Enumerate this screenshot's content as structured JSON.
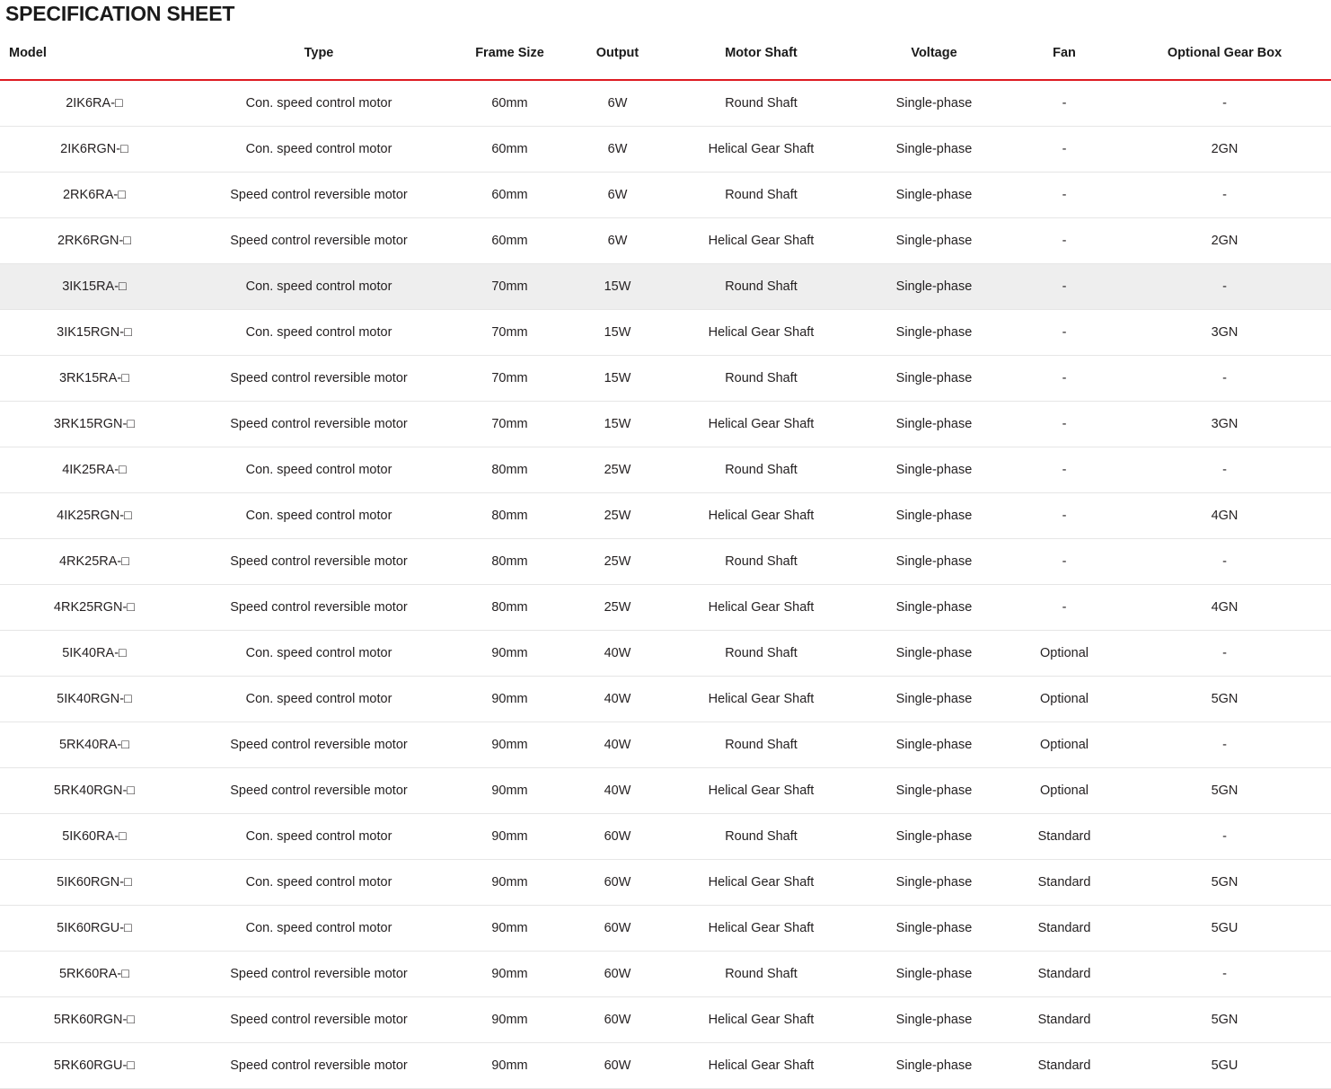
{
  "title": "SPECIFICATION SHEET",
  "accent_color": "#dd1a21",
  "highlight_row_color": "#eeeeee",
  "row_divider_color": "#e6e6e6",
  "table": {
    "columns": [
      {
        "key": "model",
        "label": "Model"
      },
      {
        "key": "type",
        "label": "Type"
      },
      {
        "key": "frame",
        "label": "Frame Size"
      },
      {
        "key": "output",
        "label": "Output"
      },
      {
        "key": "shaft",
        "label": "Motor Shaft"
      },
      {
        "key": "voltage",
        "label": "Voltage"
      },
      {
        "key": "fan",
        "label": "Fan"
      },
      {
        "key": "gearbox",
        "label": "Optional Gear Box"
      }
    ],
    "highlighted_row_index": 4,
    "rows": [
      {
        "model": "2IK6RA-□",
        "type": "Con. speed control motor",
        "frame": "60mm",
        "output": "6W",
        "shaft": "Round Shaft",
        "voltage": "Single-phase",
        "fan": "-",
        "gearbox": "-"
      },
      {
        "model": "2IK6RGN-□",
        "type": "Con. speed control motor",
        "frame": "60mm",
        "output": "6W",
        "shaft": "Helical Gear Shaft",
        "voltage": "Single-phase",
        "fan": "-",
        "gearbox": "2GN"
      },
      {
        "model": "2RK6RA-□",
        "type": "Speed control reversible motor",
        "frame": "60mm",
        "output": "6W",
        "shaft": "Round Shaft",
        "voltage": "Single-phase",
        "fan": "-",
        "gearbox": "-"
      },
      {
        "model": "2RK6RGN-□",
        "type": "Speed control reversible motor",
        "frame": "60mm",
        "output": "6W",
        "shaft": "Helical Gear Shaft",
        "voltage": "Single-phase",
        "fan": "-",
        "gearbox": "2GN"
      },
      {
        "model": "3IK15RA-□",
        "type": "Con. speed control motor",
        "frame": "70mm",
        "output": "15W",
        "shaft": "Round Shaft",
        "voltage": "Single-phase",
        "fan": "-",
        "gearbox": "-"
      },
      {
        "model": "3IK15RGN-□",
        "type": "Con. speed control motor",
        "frame": "70mm",
        "output": "15W",
        "shaft": "Helical Gear Shaft",
        "voltage": "Single-phase",
        "fan": "-",
        "gearbox": "3GN"
      },
      {
        "model": "3RK15RA-□",
        "type": "Speed control reversible motor",
        "frame": "70mm",
        "output": "15W",
        "shaft": "Round Shaft",
        "voltage": "Single-phase",
        "fan": "-",
        "gearbox": "-"
      },
      {
        "model": "3RK15RGN-□",
        "type": "Speed control reversible motor",
        "frame": "70mm",
        "output": "15W",
        "shaft": "Helical Gear Shaft",
        "voltage": "Single-phase",
        "fan": "-",
        "gearbox": "3GN"
      },
      {
        "model": "4IK25RA-□",
        "type": "Con. speed control motor",
        "frame": "80mm",
        "output": "25W",
        "shaft": "Round Shaft",
        "voltage": "Single-phase",
        "fan": "-",
        "gearbox": "-"
      },
      {
        "model": "4IK25RGN-□",
        "type": "Con. speed control motor",
        "frame": "80mm",
        "output": "25W",
        "shaft": "Helical Gear Shaft",
        "voltage": "Single-phase",
        "fan": "-",
        "gearbox": "4GN"
      },
      {
        "model": "4RK25RA-□",
        "type": "Speed control reversible motor",
        "frame": "80mm",
        "output": "25W",
        "shaft": "Round Shaft",
        "voltage": "Single-phase",
        "fan": "-",
        "gearbox": "-"
      },
      {
        "model": "4RK25RGN-□",
        "type": "Speed control reversible motor",
        "frame": "80mm",
        "output": "25W",
        "shaft": "Helical Gear Shaft",
        "voltage": "Single-phase",
        "fan": "-",
        "gearbox": "4GN"
      },
      {
        "model": "5IK40RA-□",
        "type": "Con. speed control motor",
        "frame": "90mm",
        "output": "40W",
        "shaft": "Round Shaft",
        "voltage": "Single-phase",
        "fan": "Optional",
        "gearbox": "-"
      },
      {
        "model": "5IK40RGN-□",
        "type": "Con. speed control motor",
        "frame": "90mm",
        "output": "40W",
        "shaft": "Helical Gear Shaft",
        "voltage": "Single-phase",
        "fan": "Optional",
        "gearbox": "5GN"
      },
      {
        "model": "5RK40RA-□",
        "type": "Speed control reversible motor",
        "frame": "90mm",
        "output": "40W",
        "shaft": "Round Shaft",
        "voltage": "Single-phase",
        "fan": "Optional",
        "gearbox": "-"
      },
      {
        "model": "5RK40RGN-□",
        "type": "Speed control reversible motor",
        "frame": "90mm",
        "output": "40W",
        "shaft": "Helical Gear Shaft",
        "voltage": "Single-phase",
        "fan": "Optional",
        "gearbox": "5GN"
      },
      {
        "model": "5IK60RA-□",
        "type": "Con. speed control motor",
        "frame": "90mm",
        "output": "60W",
        "shaft": "Round Shaft",
        "voltage": "Single-phase",
        "fan": "Standard",
        "gearbox": "-"
      },
      {
        "model": "5IK60RGN-□",
        "type": "Con. speed control motor",
        "frame": "90mm",
        "output": "60W",
        "shaft": "Helical Gear Shaft",
        "voltage": "Single-phase",
        "fan": "Standard",
        "gearbox": "5GN"
      },
      {
        "model": "5IK60RGU-□",
        "type": "Con. speed control motor",
        "frame": "90mm",
        "output": "60W",
        "shaft": "Helical Gear Shaft",
        "voltage": "Single-phase",
        "fan": "Standard",
        "gearbox": "5GU"
      },
      {
        "model": "5RK60RA-□",
        "type": "Speed control reversible motor",
        "frame": "90mm",
        "output": "60W",
        "shaft": "Round Shaft",
        "voltage": "Single-phase",
        "fan": "Standard",
        "gearbox": "-"
      },
      {
        "model": "5RK60RGN-□",
        "type": "Speed control reversible motor",
        "frame": "90mm",
        "output": "60W",
        "shaft": "Helical Gear Shaft",
        "voltage": "Single-phase",
        "fan": "Standard",
        "gearbox": "5GN"
      },
      {
        "model": "5RK60RGU-□",
        "type": "Speed control reversible motor",
        "frame": "90mm",
        "output": "60W",
        "shaft": "Helical Gear Shaft",
        "voltage": "Single-phase",
        "fan": "Standard",
        "gearbox": "5GU"
      }
    ]
  }
}
